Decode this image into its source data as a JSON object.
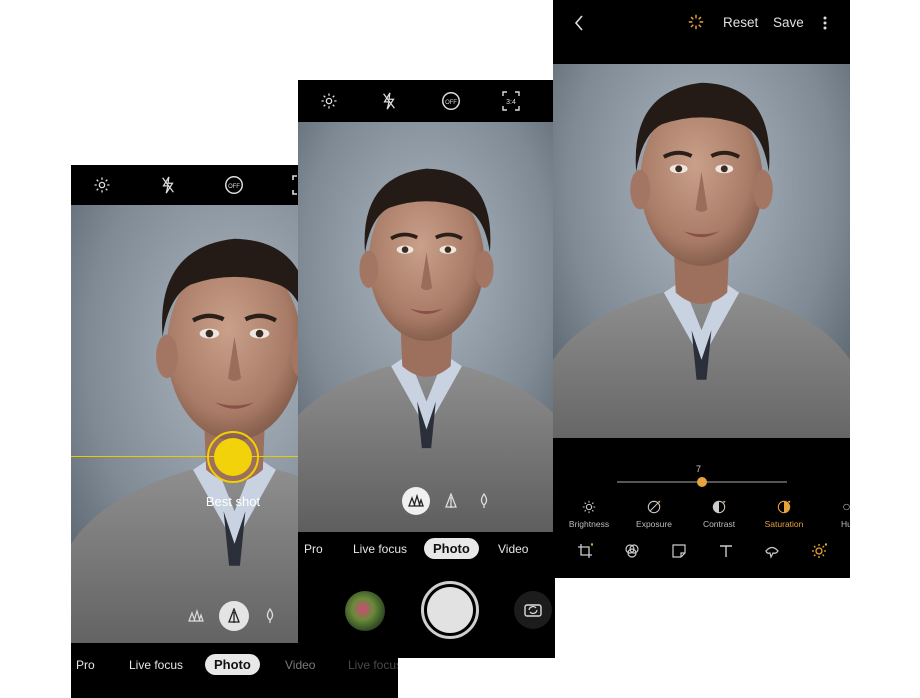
{
  "phone1": {
    "top_icons": [
      "gear-icon",
      "flash-off-icon",
      "timer-off-icon",
      "aspect-ratio-icon"
    ],
    "best_shot_label": "Best shot",
    "focus_options": [
      "multi-face-icon",
      "single-face-icon",
      "tree-icon"
    ],
    "modes": [
      "Pro",
      "Live focus",
      "Photo",
      "Video",
      "Live focus"
    ],
    "active_mode": "Photo",
    "accent_color": "#f5d000"
  },
  "phone2": {
    "top_icons": [
      "gear-icon",
      "flash-off-icon",
      "timer-off-icon",
      "aspect-ratio-icon"
    ],
    "aspect_label": "3:4",
    "timer_label": "OFF",
    "focus_options": [
      "multi-face-icon",
      "single-face-icon",
      "tree-icon"
    ],
    "modes": [
      "Pro",
      "Live focus",
      "Photo",
      "Video"
    ],
    "active_mode": "Photo",
    "controls": [
      "gallery-thumbnail",
      "shutter-button",
      "switch-camera-icon"
    ]
  },
  "phone3": {
    "back_icon": "chevron-left-icon",
    "auto_enhance_icon": "magic-wand-icon",
    "reset_label": "Reset",
    "save_label": "Save",
    "more_icon": "more-vertical-icon",
    "slider": {
      "value": "7",
      "level": 0.5
    },
    "adjust_tools": [
      {
        "label": "Brightness",
        "icon": "brightness-icon"
      },
      {
        "label": "Exposure",
        "icon": "exposure-icon"
      },
      {
        "label": "Contrast",
        "icon": "contrast-icon"
      },
      {
        "label": "Saturation",
        "icon": "saturation-icon",
        "active": true
      },
      {
        "label": "Hue",
        "icon": "hue-icon"
      }
    ],
    "bottom_tools": [
      "crop-rotate-icon",
      "filters-icon",
      "sticker-icon",
      "text-icon",
      "paint-brush-icon",
      "adjust-sun-icon"
    ],
    "accent_color": "#e6a23c"
  }
}
